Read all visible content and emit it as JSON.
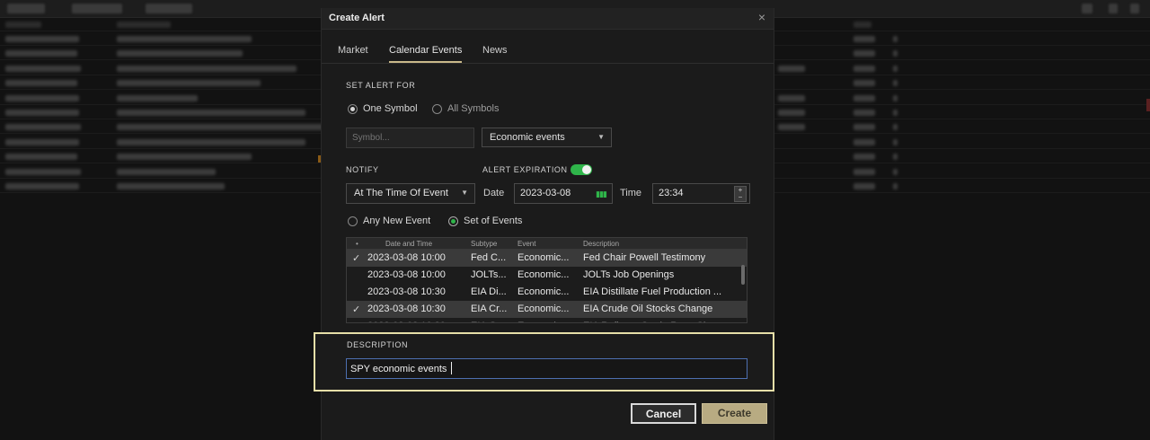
{
  "dialog": {
    "title": "Create Alert",
    "close_symbol": "×"
  },
  "tabs": [
    {
      "label": "Market"
    },
    {
      "label": "Calendar Events"
    },
    {
      "label": "News"
    }
  ],
  "set_alert_for": {
    "label": "SET ALERT FOR",
    "one_symbol": "One Symbol",
    "all_symbols": "All Symbols",
    "selected": "One Symbol",
    "symbol_placeholder": "Symbol...",
    "event_type": "Economic events"
  },
  "notify": {
    "label": "NOTIFY",
    "timing": "At The Time Of Event"
  },
  "expiration": {
    "label": "ALERT EXPIRATION",
    "enabled": true,
    "date_label": "Date",
    "date_value": "2023-03-08",
    "time_label": "Time",
    "time_value": "23:34"
  },
  "event_mode": {
    "any_new_event": "Any New Event",
    "set_of_events": "Set of Events",
    "selected": "Set of Events"
  },
  "events_table": {
    "headers": [
      "•",
      "Date and Time",
      "Subtype",
      "Event",
      "Description"
    ],
    "rows": [
      {
        "checked": "✓",
        "datetime": "2023-03-08 10:00",
        "subtype": "Fed C...",
        "event": "Economic...",
        "description": "Fed Chair Powell Testimony",
        "selected": true
      },
      {
        "checked": "",
        "datetime": "2023-03-08 10:00",
        "subtype": "JOLTs...",
        "event": "Economic...",
        "description": "JOLTs Job Openings",
        "selected": false
      },
      {
        "checked": "",
        "datetime": "2023-03-08 10:30",
        "subtype": "EIA Di...",
        "event": "Economic...",
        "description": "EIA Distillate Fuel Production ...",
        "selected": false
      },
      {
        "checked": "✓",
        "datetime": "2023-03-08 10:30",
        "subtype": "EIA Cr...",
        "event": "Economic...",
        "description": "EIA Crude Oil Stocks Change",
        "selected": true
      }
    ]
  },
  "description": {
    "label": "DESCRIPTION",
    "value": "SPY economic events"
  },
  "buttons": {
    "cancel": "Cancel",
    "create": "Create"
  },
  "colors": {
    "accent_green": "#2fb54a",
    "highlight_frame": "#e6dfa8",
    "create_button": "#b8ab82"
  }
}
